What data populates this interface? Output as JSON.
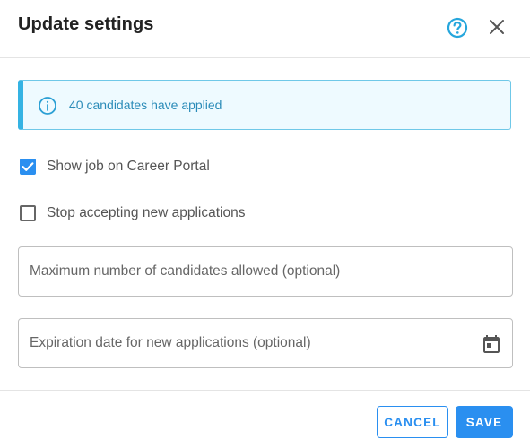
{
  "dialog": {
    "title": "Update settings",
    "help_icon": "help-circle-icon",
    "close_icon": "close-icon"
  },
  "info": {
    "icon": "info-circle-icon",
    "text": "40 candidates have applied"
  },
  "options": {
    "show_on_portal": {
      "label": "Show job on Career Portal",
      "checked": true
    },
    "stop_accepting": {
      "label": "Stop accepting new applications",
      "checked": false
    }
  },
  "fields": {
    "max_candidates": {
      "placeholder": "Maximum number of candidates allowed (optional)",
      "value": ""
    },
    "expiration_date": {
      "placeholder": "Expiration date for new applications (optional)",
      "value": "",
      "icon": "calendar-icon"
    }
  },
  "buttons": {
    "cancel": "CANCEL",
    "save": "SAVE"
  },
  "colors": {
    "accent": "#2a8ff0",
    "info_border": "#35b3e3",
    "info_text": "#2a8bb8"
  }
}
